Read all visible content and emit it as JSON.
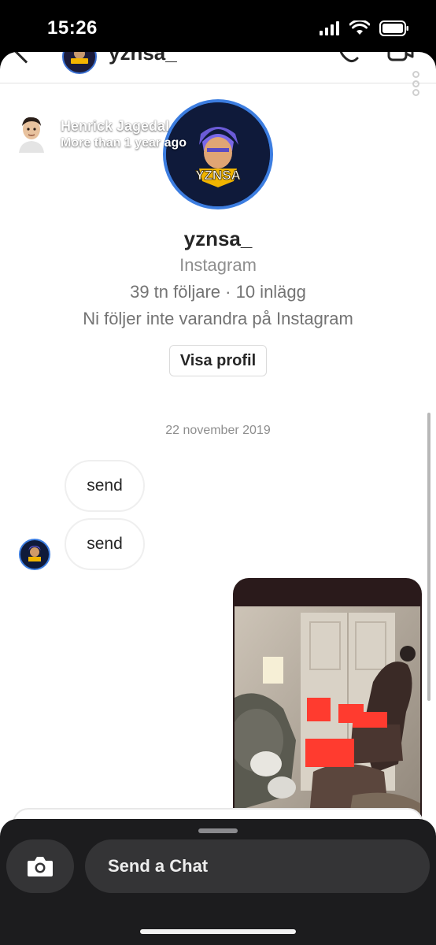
{
  "status_bar": {
    "time": "15:26"
  },
  "instagram": {
    "header": {
      "username": "yznsa_"
    },
    "profile": {
      "avatar_text": "YZNSA",
      "username": "yznsa_",
      "platform": "Instagram",
      "stats": "39 tn följare · 10 inlägg",
      "relation": "Ni följer inte varandra på Instagram",
      "view_profile_label": "Visa profil"
    },
    "date_divider": "22 november 2019",
    "messages": [
      {
        "text": "send"
      },
      {
        "text": "send"
      }
    ],
    "media_redacted": true
  },
  "snapchat": {
    "story_overlay": {
      "sender_name": "Henrick Jagedal",
      "time_ago": "More than 1 year ago"
    },
    "chat_input": {
      "placeholder": "Send a Chat"
    }
  },
  "colors": {
    "avatar_ring": "#3c7de0",
    "snap_panel": "#1c1c1e",
    "redaction": "#ff3b2f"
  }
}
